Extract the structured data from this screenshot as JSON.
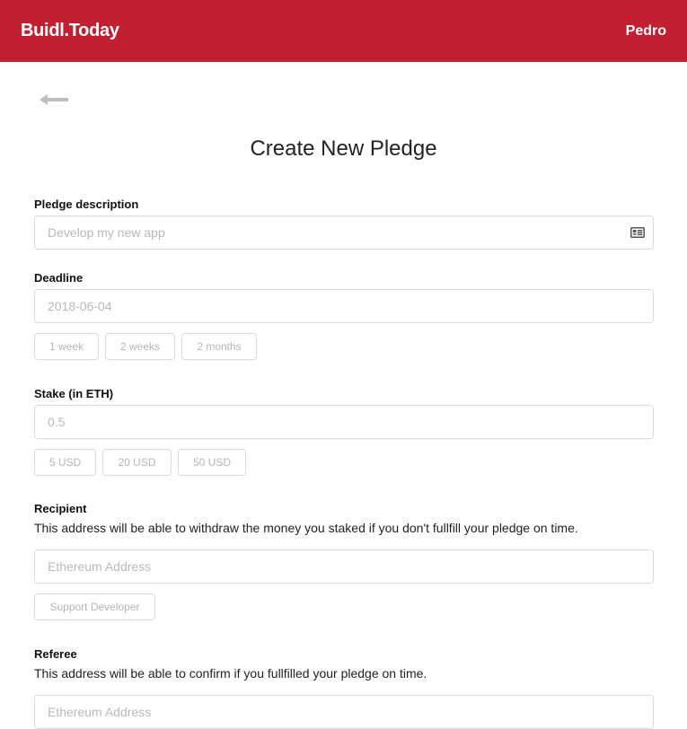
{
  "navbar": {
    "brand": "Buidl.Today",
    "user": "Pedro",
    "color": "#c21f32"
  },
  "back_icon": "arrow-left-icon",
  "page_title": "Create New Pledge",
  "description": {
    "label": "Pledge description",
    "placeholder": "Develop my new app",
    "icon": "address-card-icon"
  },
  "deadline": {
    "label": "Deadline",
    "placeholder": "2018-06-04",
    "presets": [
      "1 week",
      "2 weeks",
      "2 months"
    ]
  },
  "stake": {
    "label": "Stake (in ETH)",
    "placeholder": "0.5",
    "presets": [
      "5 USD",
      "20 USD",
      "50 USD"
    ]
  },
  "recipient": {
    "label": "Recipient",
    "help": "This address will be able to withdraw the money you staked if you don't fullfill your pledge on time.",
    "placeholder": "Ethereum Address",
    "preset": "Support Developer"
  },
  "referee": {
    "label": "Referee",
    "help": "This address will be able to confirm if you fullfilled your pledge on time.",
    "placeholder": "Ethereum Address"
  }
}
